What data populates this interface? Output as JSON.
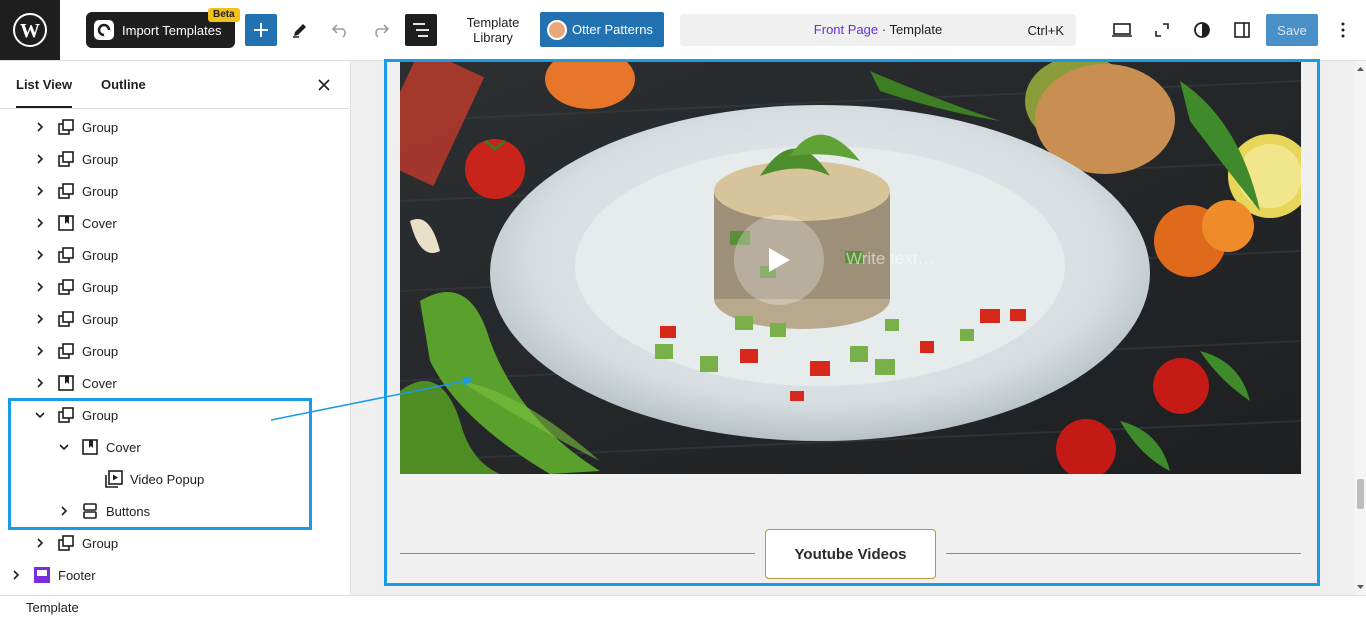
{
  "toolbar": {
    "import_label": "Import Templates",
    "beta_badge": "Beta",
    "template_library_line1": "Template",
    "template_library_line2": "Library",
    "otter_label": "Otter Patterns",
    "doc_page": "Front Page",
    "doc_sep": " · ",
    "doc_type": "Template",
    "doc_shortcut": "Ctrl+K",
    "save_label": "Save"
  },
  "sidebar": {
    "tabs": [
      "List View",
      "Outline"
    ],
    "items": [
      {
        "label": "Group",
        "icon": "group-icon"
      },
      {
        "label": "Group",
        "icon": "group-icon"
      },
      {
        "label": "Group",
        "icon": "group-icon"
      },
      {
        "label": "Cover",
        "icon": "cover-icon"
      },
      {
        "label": "Group",
        "icon": "group-icon"
      },
      {
        "label": "Group",
        "icon": "group-icon"
      },
      {
        "label": "Group",
        "icon": "group-icon"
      },
      {
        "label": "Group",
        "icon": "group-icon"
      },
      {
        "label": "Cover",
        "icon": "cover-icon"
      },
      {
        "label": "Group",
        "icon": "group-icon"
      },
      {
        "label": "Cover",
        "icon": "cover-icon"
      },
      {
        "label": "Video Popup",
        "icon": "video-icon"
      },
      {
        "label": "Buttons",
        "icon": "buttons-icon"
      },
      {
        "label": "Group",
        "icon": "group-icon"
      },
      {
        "label": "Footer",
        "icon": "footer-icon"
      }
    ]
  },
  "canvas": {
    "write_placeholder": "Write text…",
    "youtube_button": "Youtube Videos"
  },
  "status": {
    "breadcrumb": "Template"
  },
  "colors": {
    "accent": "#2271b1",
    "highlight": "#1a9be8",
    "page_link": "#6a2ed6"
  }
}
